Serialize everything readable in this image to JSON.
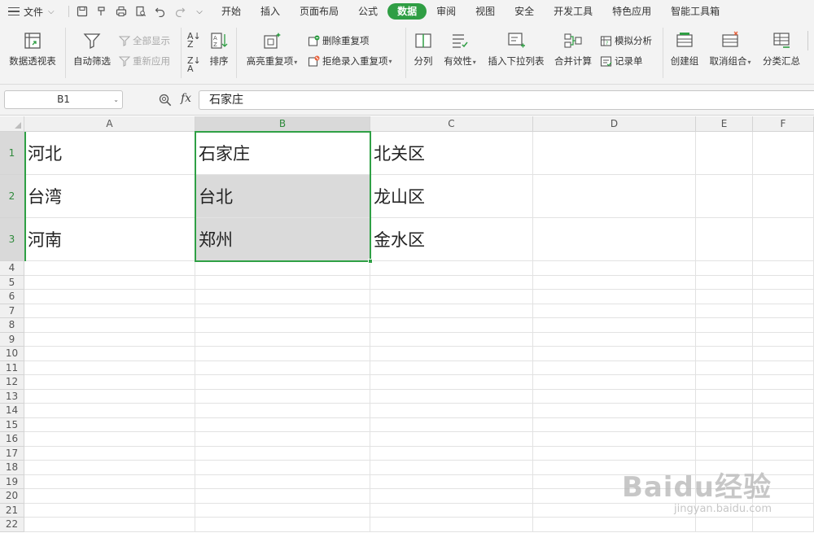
{
  "menubar": {
    "file_label": "文件",
    "tabs": [
      {
        "label": "开始",
        "active": false
      },
      {
        "label": "插入",
        "active": false
      },
      {
        "label": "页面布局",
        "active": false
      },
      {
        "label": "公式",
        "active": false
      },
      {
        "label": "数据",
        "active": true
      },
      {
        "label": "审阅",
        "active": false
      },
      {
        "label": "视图",
        "active": false
      },
      {
        "label": "安全",
        "active": false
      },
      {
        "label": "开发工具",
        "active": false
      },
      {
        "label": "特色应用",
        "active": false
      },
      {
        "label": "智能工具箱",
        "active": false
      }
    ],
    "accent_color": "#2f9e44"
  },
  "ribbon": {
    "pivot_table": "数据透视表",
    "auto_filter": "自动筛选",
    "show_all": "全部显示",
    "reapply": "重新应用",
    "sort": "排序",
    "highlight_duplicates": "高亮重复项",
    "delete_duplicates": "删除重复项",
    "reject_duplicate_entry": "拒绝录入重复项",
    "split_column": "分列",
    "validity": "有效性",
    "insert_dropdown": "插入下拉列表",
    "consolidate": "合并计算",
    "what_if": "模拟分析",
    "record_form": "记录单",
    "create_group": "创建组",
    "ungroup": "取消组合",
    "subtotal": "分类汇总"
  },
  "formula_bar": {
    "name_box": "B1",
    "fx_label": "fx",
    "value": "石家庄"
  },
  "sheet": {
    "columns": [
      "A",
      "B",
      "C",
      "D",
      "E",
      "F"
    ],
    "rows": [
      "1",
      "2",
      "3",
      "4",
      "5",
      "6",
      "7",
      "8",
      "9",
      "10",
      "11",
      "12",
      "13",
      "14",
      "15",
      "16",
      "17",
      "18",
      "19",
      "20",
      "21",
      "22"
    ],
    "cells": {
      "A1": "河北",
      "B1": "石家庄",
      "C1": "北关区",
      "A2": "台湾",
      "B2": "台北",
      "C2": "龙山区",
      "A3": "河南",
      "B3": "郑州",
      "C3": "金水区"
    },
    "selection": "B1:B3",
    "selection_color": "#2fa045"
  },
  "watermark": {
    "text": "Baidu经验",
    "url": "jingyan.baidu.com"
  }
}
